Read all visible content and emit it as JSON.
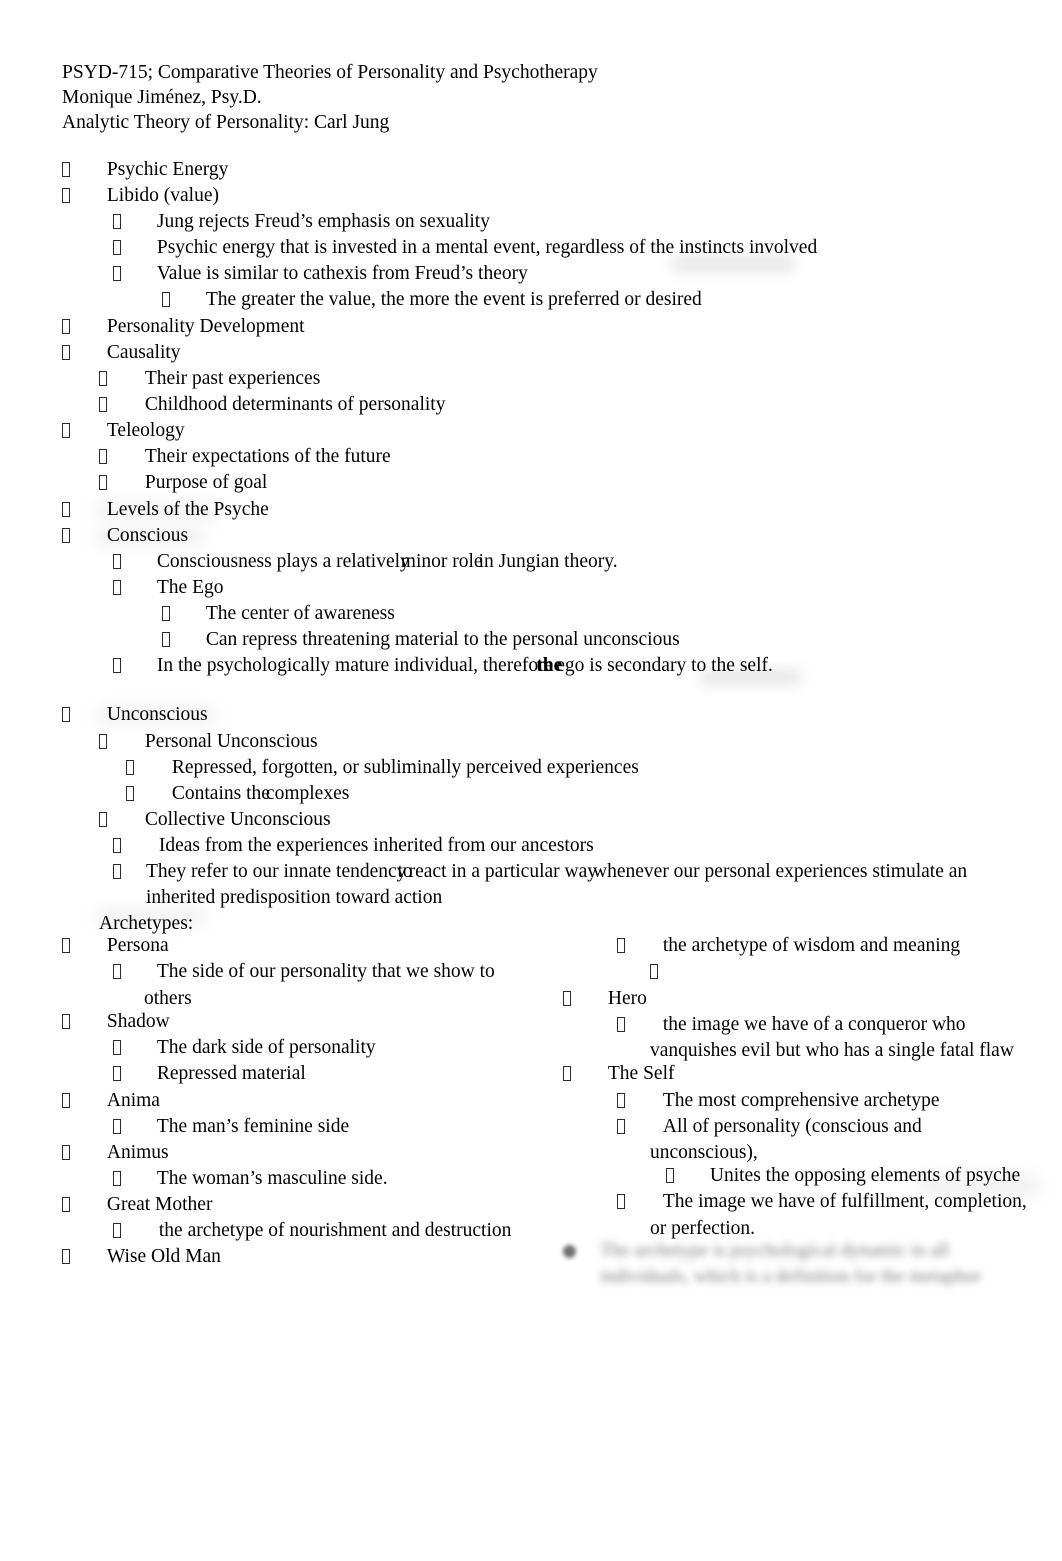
{
  "document": {
    "header": [
      "PSYD-715; Comparative Theories of Personality and Psychotherapy",
      "Monique Jiménez, Psy.D.",
      "Analytic Theory of Personality: Carl Jung"
    ]
  },
  "outline": {
    "psychic_energy": "Psychic Energy",
    "libido": "Libido (value)",
    "libido_a": "Jung rejects Freud’s emphasis on sexuality",
    "libido_b": "Psychic energy that is invested in a mental event, regardless of the instincts involved",
    "libido_c": "Value is similar to cathexis from Freud’s theory",
    "libido_c1": "The greater the value, the more the event is preferred or desired",
    "personality_development": "Personality Development",
    "causality": "Causality",
    "causality_a": "Their past experiences",
    "causality_b": "Childhood determinants of personality",
    "teleology": "Teleology",
    "teleology_a": "Their expectations of the future",
    "teleology_b": "Purpose of goal",
    "levels_of_psyche": "Levels of the Psyche",
    "conscious": "Conscious",
    "conscious_a_p1": "Consciousness plays a relatively",
    "conscious_a_p2": "minor role",
    "conscious_a_p3": "in Jungian theory.",
    "conscious_b": "The Ego",
    "conscious_b1": "The center of awareness",
    "conscious_b2": "Can repress threatening material to the personal unconscious",
    "conscious_c_p1": "In the psychologically mature individual, therefore",
    "conscious_c_p2": "the",
    "conscious_c_p3": "ego is secondary to the self.",
    "unconscious": "Unconscious",
    "personal_unconscious": "Personal Unconscious",
    "personal_a": "Repressed, forgotten, or subliminally perceived experiences",
    "personal_b_p1": "Contains the",
    "personal_b_p2": "complexes",
    "collective_unconscious": "Collective Unconscious",
    "collective_a": "Ideas from the experiences inherited from our ancestors",
    "collective_b_p1": "They refer to our innate tendency",
    "collective_b_p2": "to",
    "collective_b_p3": "react in a particular way",
    "collective_b_p4": "whenever our personal experiences stimulate an",
    "collective_b_p5": "inherited predisposition toward action",
    "archetypes_label": "Archetypes:"
  },
  "archetypes_left": {
    "persona": "Persona",
    "persona_a_line1": "The side of our personality that we show to",
    "persona_a_line2": "others",
    "shadow": "Shadow",
    "shadow_a": "The dark side of personality",
    "shadow_b": "Repressed material",
    "anima": "Anima",
    "anima_a": "The man’s feminine side",
    "animus": "Animus",
    "animus_a": "The woman’s masculine side.",
    "great_mother": "Great Mother",
    "great_mother_a": "the archetype of nourishment and destruction",
    "wise_old_man": "Wise Old Man"
  },
  "archetypes_right": {
    "wise_old_man_a": "the archetype of wisdom and meaning",
    "empty_bullet": "",
    "hero": "Hero",
    "hero_a_line1": "the image we have of a conqueror who",
    "hero_a_line2": "vanquishes evil but who has a single fatal flaw",
    "the_self": "The Self",
    "self_a": "The most comprehensive archetype",
    "self_b_line1": "All of personality (conscious and",
    "self_b_line2": "unconscious),",
    "self_b1": "Unites the opposing elements of psyche",
    "self_c_line1": "The image we have of fulfillment, completion,",
    "self_c_line2": "or perfection."
  },
  "redacted": {
    "line1": "The archetype is psychological dynamic in all",
    "line2": "individuals, which is a definition for the metaphor"
  }
}
